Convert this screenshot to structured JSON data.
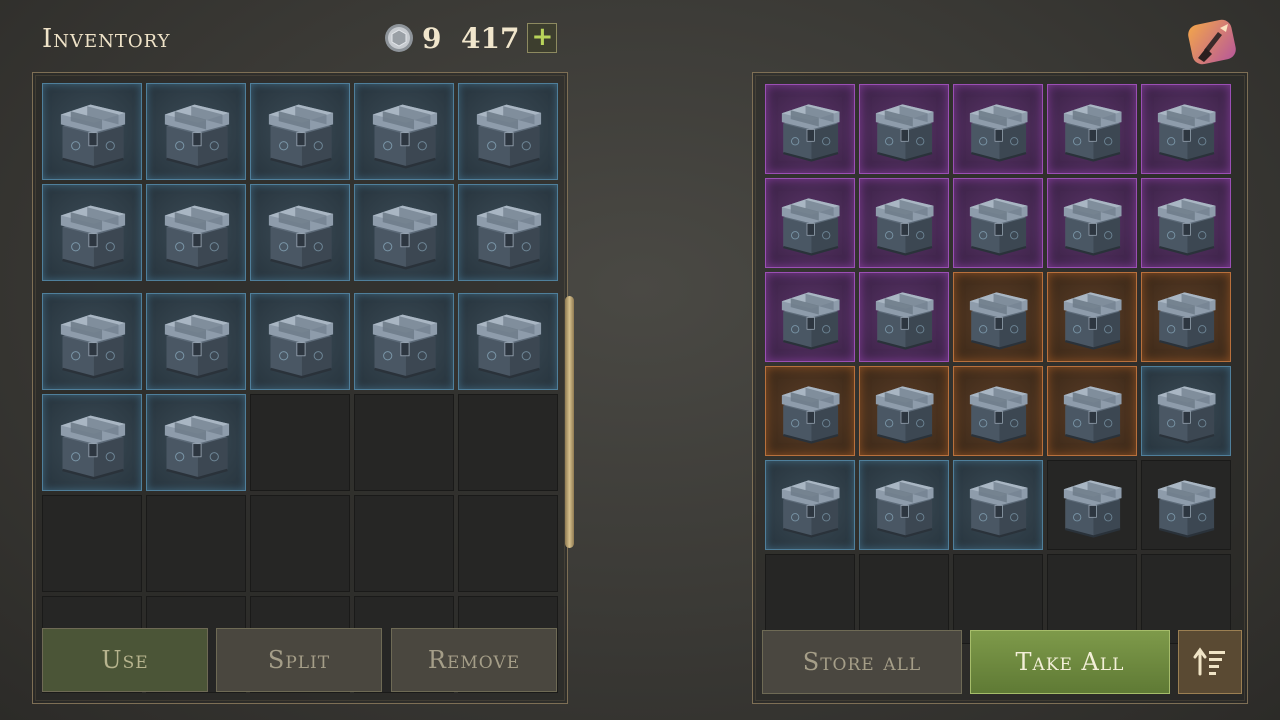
{
  "header": {
    "title": "Inventory",
    "currency_amount": "9  417",
    "plus_label": "+"
  },
  "colors": {
    "blue_rarity": "#4f7f9b",
    "purple_rarity": "#9a4fb4",
    "orange_rarity": "#b8703c",
    "take_all_green": "#6f8a3f"
  },
  "icons": {
    "currency": "silver-coin-icon",
    "corner": "clean-up-broom-icon",
    "sort": "sort-icon",
    "item": "steel-chest-icon"
  },
  "inventory": {
    "columns": 5,
    "cells": [
      "blue",
      "blue",
      "blue",
      "blue",
      "blue",
      "blue",
      "blue",
      "blue",
      "blue",
      "blue",
      "blue",
      "blue",
      "blue",
      "blue",
      "blue",
      "blue",
      "blue",
      "empty",
      "empty",
      "empty",
      "empty",
      "empty",
      "empty",
      "empty",
      "empty",
      "empty",
      "empty",
      "empty",
      "empty",
      "empty"
    ],
    "buttons": {
      "use": "Use",
      "split": "Split",
      "remove": "Remove"
    }
  },
  "storage": {
    "columns": 5,
    "cells": [
      "purple",
      "purple",
      "purple",
      "purple",
      "purple",
      "purple",
      "purple",
      "purple",
      "purple",
      "purple",
      "purple",
      "purple",
      "orange",
      "orange",
      "orange",
      "orange",
      "orange",
      "orange",
      "orange",
      "blue",
      "blue",
      "blue",
      "blue",
      "dark-item",
      "dark-item",
      "empty",
      "empty",
      "empty",
      "empty",
      "empty"
    ],
    "buttons": {
      "store_all": "Store all",
      "take_all": "Take All"
    }
  }
}
